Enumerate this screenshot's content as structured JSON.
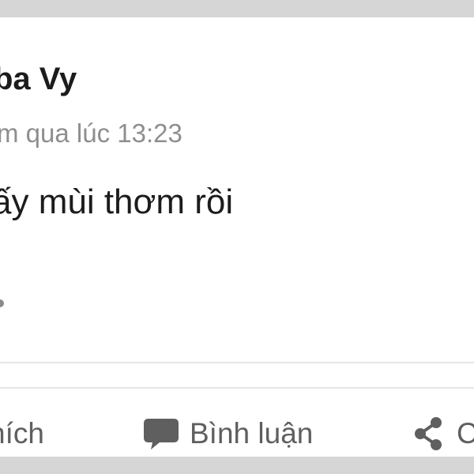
{
  "post": {
    "author_name": "ba Vy",
    "timestamp": "m qua lúc 13:23",
    "text": "ấy mùi thơm rồi"
  },
  "actions": {
    "like_label": "hích",
    "comment_label": "Bình luận",
    "share_label": "C"
  },
  "icons": {
    "comment": "speech-bubble-icon",
    "share": "share-icon"
  },
  "colors": {
    "text_primary": "#1c1c1c",
    "text_secondary": "#8e8e8e",
    "action_text": "#5f5f5f",
    "card_background": "#ffffff",
    "page_background": "#d6d6d6"
  }
}
